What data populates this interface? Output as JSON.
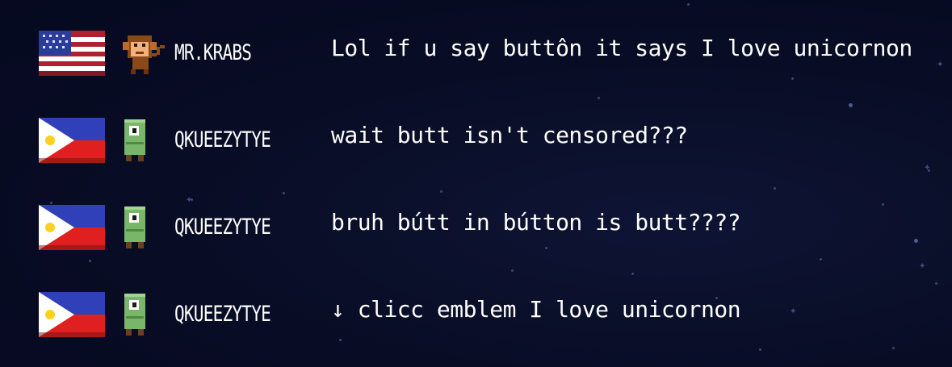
{
  "chat": {
    "messages": [
      {
        "flag": "usa-flag-icon",
        "avatar": "monkey-icon",
        "username": "MR.KRABS",
        "text": "Lol if u say buttôn it says I love unicornon"
      },
      {
        "flag": "philippines-flag-icon",
        "avatar": "green-robot-icon",
        "username": "QKUEEZYTYE",
        "text": "wait butt isn't censored???"
      },
      {
        "flag": "philippines-flag-icon",
        "avatar": "green-robot-icon",
        "username": "QKUEEZYTYE",
        "text": "bruh bútt in bútton is butt????"
      },
      {
        "flag": "philippines-flag-icon",
        "avatar": "green-robot-icon",
        "username": "QKUEEZYTYE",
        "text": "↓ clicc emblem I love unicornon"
      }
    ]
  },
  "colors": {
    "background": "#080c24",
    "text": "#ffffff",
    "star": "#3a4a7a"
  }
}
